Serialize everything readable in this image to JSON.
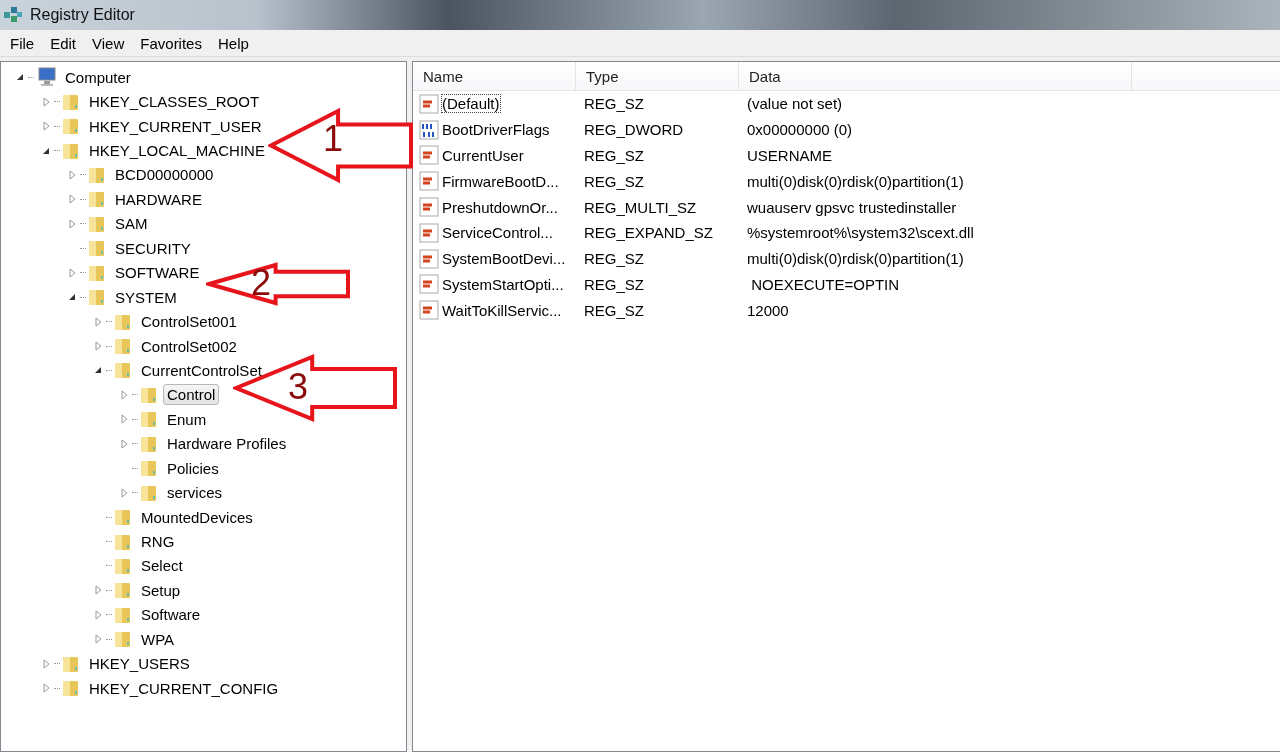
{
  "window": {
    "title": "Registry Editor"
  },
  "menu": [
    "File",
    "Edit",
    "View",
    "Favorites",
    "Help"
  ],
  "tree": [
    {
      "label": "Computer",
      "kind": "computer",
      "expanded": true,
      "selected": false,
      "children": [
        {
          "label": "HKEY_CLASSES_ROOT",
          "kind": "folder",
          "expanded": false,
          "selected": false
        },
        {
          "label": "HKEY_CURRENT_USER",
          "kind": "folder",
          "expanded": false,
          "selected": false
        },
        {
          "label": "HKEY_LOCAL_MACHINE",
          "kind": "folder",
          "expanded": true,
          "selected": false,
          "children": [
            {
              "label": "BCD00000000",
              "kind": "folder",
              "expanded": false,
              "selected": false
            },
            {
              "label": "HARDWARE",
              "kind": "folder",
              "expanded": false,
              "selected": false
            },
            {
              "label": "SAM",
              "kind": "folder",
              "expanded": false,
              "selected": false
            },
            {
              "label": "SECURITY",
              "kind": "folder",
              "selected": false
            },
            {
              "label": "SOFTWARE",
              "kind": "folder",
              "expanded": false,
              "selected": false
            },
            {
              "label": "SYSTEM",
              "kind": "folder",
              "expanded": true,
              "selected": false,
              "children": [
                {
                  "label": "ControlSet001",
                  "kind": "folder",
                  "expanded": false,
                  "selected": false
                },
                {
                  "label": "ControlSet002",
                  "kind": "folder",
                  "expanded": false,
                  "selected": false
                },
                {
                  "label": "CurrentControlSet",
                  "kind": "folder",
                  "expanded": true,
                  "selected": false,
                  "children": [
                    {
                      "label": "Control",
                      "kind": "folder",
                      "expanded": false,
                      "selected": true
                    },
                    {
                      "label": "Enum",
                      "kind": "folder",
                      "expanded": false,
                      "selected": false
                    },
                    {
                      "label": "Hardware Profiles",
                      "kind": "folder",
                      "expanded": false,
                      "selected": false
                    },
                    {
                      "label": "Policies",
                      "kind": "folder",
                      "selected": false
                    },
                    {
                      "label": "services",
                      "kind": "folder",
                      "expanded": false,
                      "selected": false
                    }
                  ]
                },
                {
                  "label": "MountedDevices",
                  "kind": "folder",
                  "selected": false
                },
                {
                  "label": "RNG",
                  "kind": "folder",
                  "selected": false
                },
                {
                  "label": "Select",
                  "kind": "folder",
                  "selected": false
                },
                {
                  "label": "Setup",
                  "kind": "folder",
                  "expanded": false,
                  "selected": false
                },
                {
                  "label": "Software",
                  "kind": "folder",
                  "expanded": false,
                  "selected": false
                },
                {
                  "label": "WPA",
                  "kind": "folder",
                  "expanded": false,
                  "selected": false
                }
              ]
            }
          ]
        },
        {
          "label": "HKEY_USERS",
          "kind": "folder",
          "expanded": false,
          "selected": false
        },
        {
          "label": "HKEY_CURRENT_CONFIG",
          "kind": "folder",
          "expanded": false,
          "selected": false
        }
      ]
    }
  ],
  "table": {
    "columns": [
      "Name",
      "Type",
      "Data"
    ],
    "rows": [
      {
        "kind": "string",
        "name": "(Default)",
        "type": "REG_SZ",
        "data": "(value not set)",
        "selected": true
      },
      {
        "kind": "binary",
        "name": "BootDriverFlags",
        "type": "REG_DWORD",
        "data": "0x00000000 (0)",
        "selected": false
      },
      {
        "kind": "string",
        "name": "CurrentUser",
        "type": "REG_SZ",
        "data": "USERNAME",
        "selected": false
      },
      {
        "kind": "string",
        "name": "FirmwareBootD...",
        "type": "REG_SZ",
        "data": "multi(0)disk(0)rdisk(0)partition(1)",
        "selected": false
      },
      {
        "kind": "string",
        "name": "PreshutdownOr...",
        "type": "REG_MULTI_SZ",
        "data": "wuauserv gpsvc trustedinstaller",
        "selected": false
      },
      {
        "kind": "string",
        "name": "ServiceControl...",
        "type": "REG_EXPAND_SZ",
        "data": "%systemroot%\\system32\\scext.dll",
        "selected": false
      },
      {
        "kind": "string",
        "name": "SystemBootDevi...",
        "type": "REG_SZ",
        "data": "multi(0)disk(0)rdisk(0)partition(1)",
        "selected": false
      },
      {
        "kind": "string",
        "name": "SystemStartOpti...",
        "type": "REG_SZ",
        "data": " NOEXECUTE=OPTIN",
        "selected": false
      },
      {
        "kind": "string",
        "name": "WaitToKillServic...",
        "type": "REG_SZ",
        "data": "12000",
        "selected": false
      }
    ]
  },
  "annotations": [
    {
      "label": "1"
    },
    {
      "label": "2"
    },
    {
      "label": "3"
    }
  ]
}
